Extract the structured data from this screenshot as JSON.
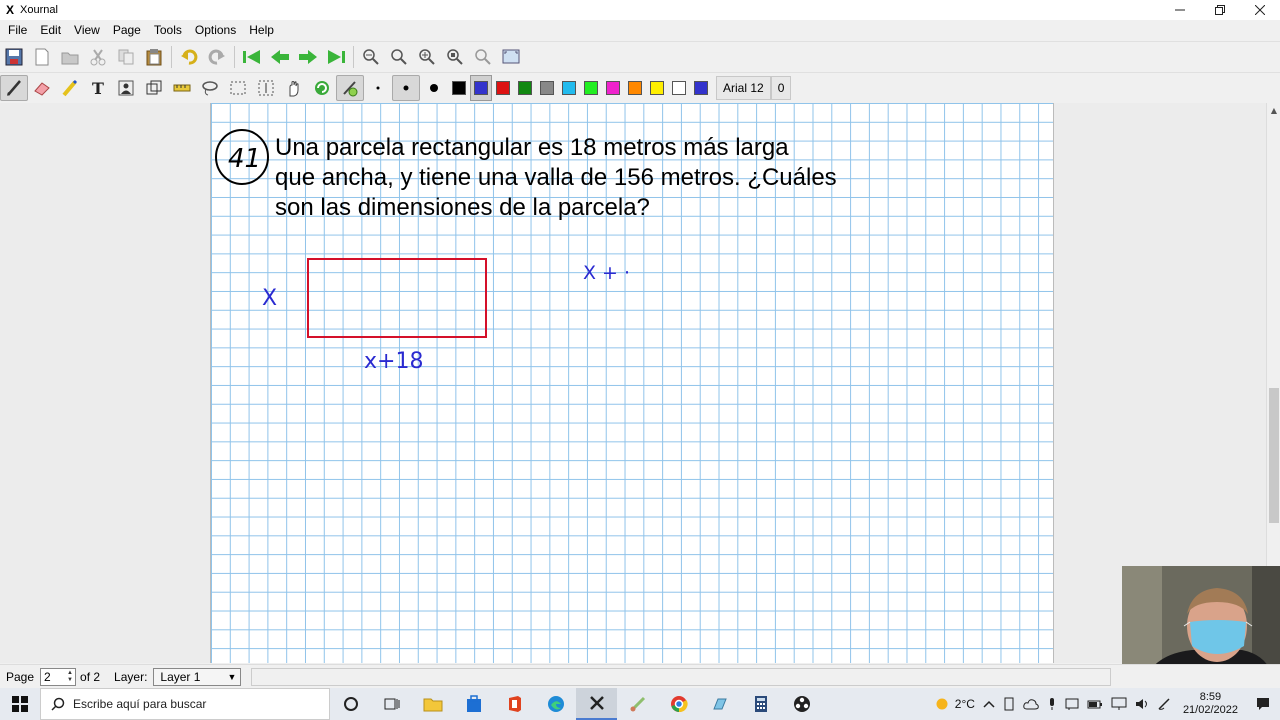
{
  "window": {
    "title": "Xournal",
    "app_icon": "X"
  },
  "menu": [
    "File",
    "Edit",
    "View",
    "Page",
    "Tools",
    "Options",
    "Help"
  ],
  "toolbar": {
    "font_label": "Arial 12",
    "zero_label": "0",
    "colors": [
      "#000000",
      "#3333cc",
      "#dd1111",
      "#118811",
      "#888888",
      "#22bbee",
      "#22ee22",
      "#ee22cc",
      "#ff8800",
      "#ffee00",
      "#ffffff",
      "#3333cc"
    ],
    "active_color_index": 1
  },
  "document": {
    "problem_number": "41",
    "problem_lines": [
      "Una parcela rectangular es 18 metros más larga",
      "que ancha, y tiene una valla de 156 metros. ¿Cuáles",
      "son las dimensiones de la parcela?"
    ],
    "side_label": "X",
    "bottom_label": "x+18",
    "partial_expression": "X + ·"
  },
  "status": {
    "page_label": "Page",
    "page_value": "2",
    "of_label": "of 2",
    "layer_label": "Layer:",
    "layer_value": "Layer 1"
  },
  "taskbar": {
    "search_placeholder": "Escribe aquí para buscar",
    "temperature": "2°C",
    "time": "8:59",
    "date": "21/02/2022"
  }
}
